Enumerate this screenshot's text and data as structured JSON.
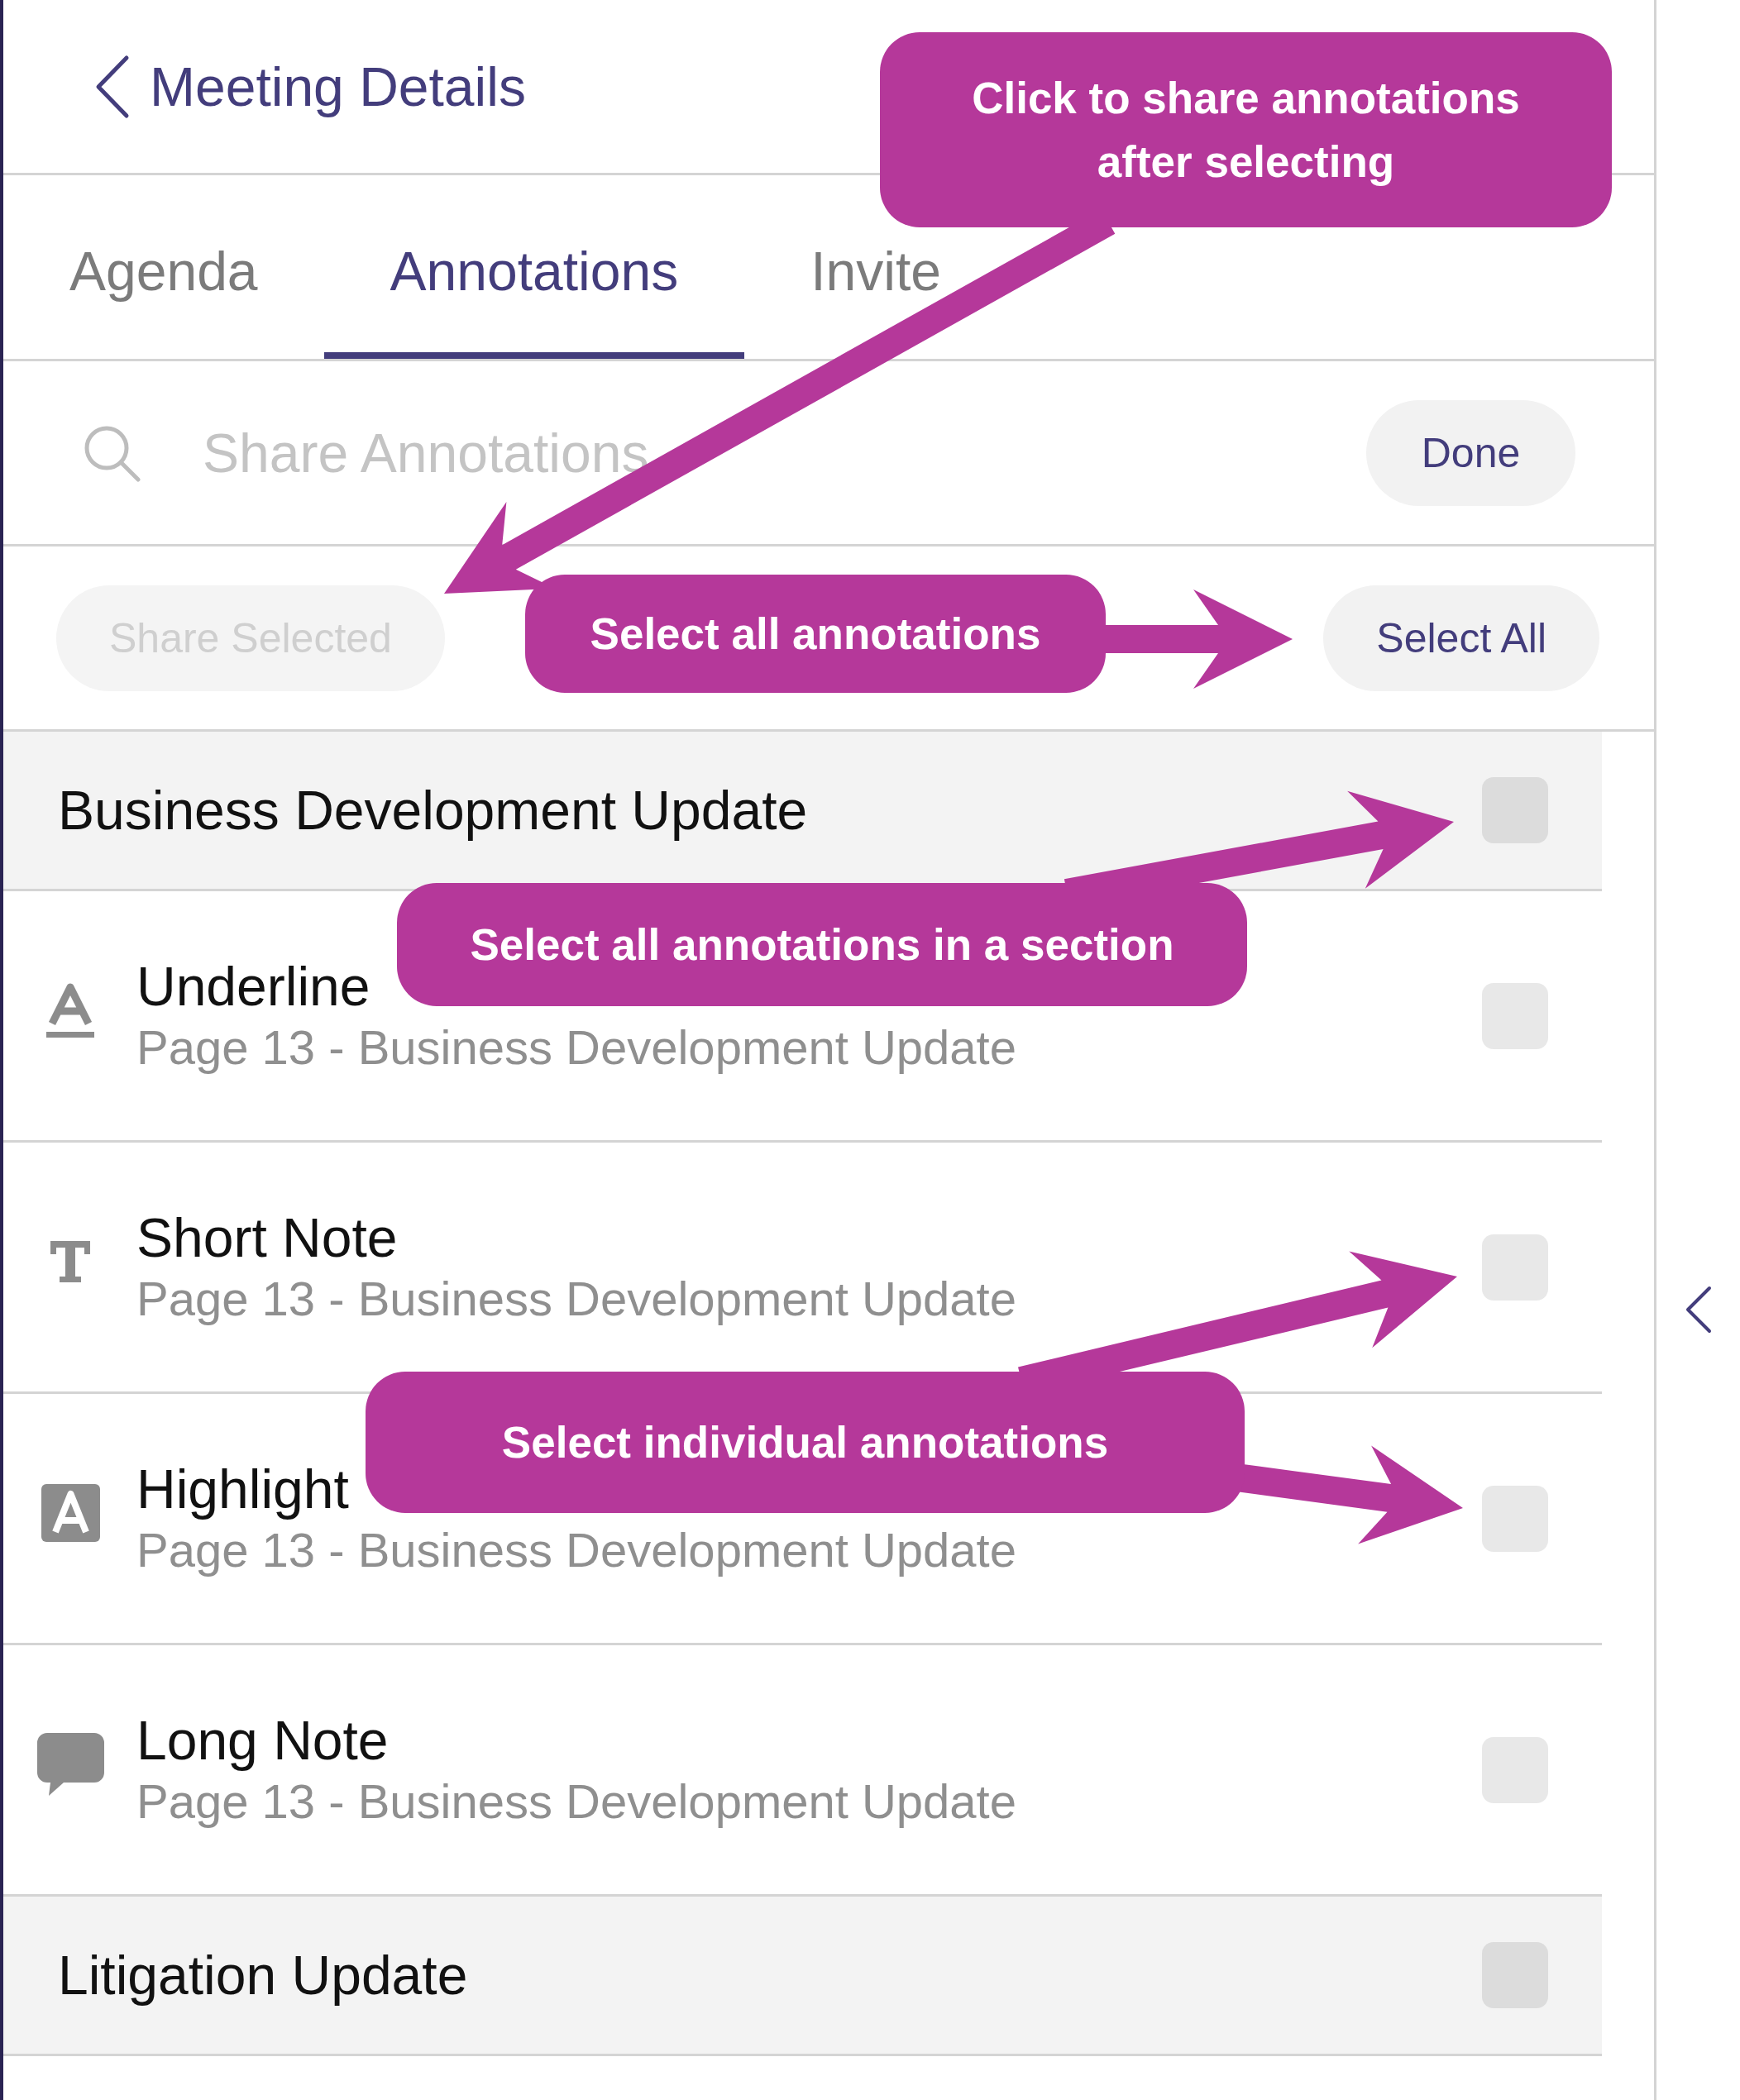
{
  "header": {
    "back_label": "Meeting Details"
  },
  "tabs": [
    {
      "label": "Agenda",
      "selected": false
    },
    {
      "label": "Annotations",
      "selected": true
    },
    {
      "label": "Invite",
      "selected": false
    }
  ],
  "search": {
    "placeholder": "Share Annotations",
    "button": "Done"
  },
  "actions": [
    {
      "label": "Share Selected",
      "disabled": true
    },
    {
      "label": "Select All",
      "disabled": false
    }
  ],
  "sections": [
    {
      "title": "Business Development Update",
      "checked": false,
      "items": [
        {
          "kind": "underline",
          "title": "Underline",
          "subtitle": "Page 13 - Business Development Update",
          "checked": false
        },
        {
          "kind": "short_note",
          "title": "Short Note",
          "subtitle": "Page 13 - Business Development Update",
          "checked": false
        },
        {
          "kind": "highlight",
          "title": "Highlight",
          "subtitle": "Page 13 - Business Development Update",
          "checked": false
        },
        {
          "kind": "long_note",
          "title": "Long Note",
          "subtitle": "Page 13 - Business Development Update",
          "checked": false
        }
      ]
    },
    {
      "title": "Litigation Update",
      "checked": false
    }
  ],
  "callouts": [
    {
      "text": "Click to share annotations after selecting"
    },
    {
      "text": "Select all annotations"
    },
    {
      "text": "Select all annotations in a section"
    },
    {
      "text": "Select individual annotations"
    }
  ]
}
